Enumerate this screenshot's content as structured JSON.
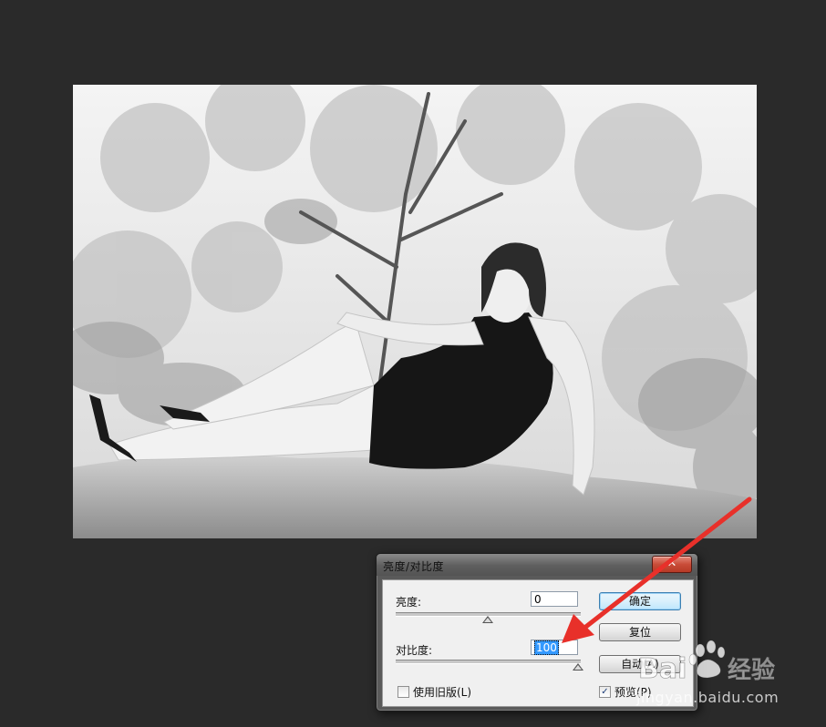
{
  "dialog": {
    "title": "亮度/对比度",
    "close_glyph": "✕",
    "brightness": {
      "label": "亮度:",
      "value": "0"
    },
    "contrast": {
      "label": "对比度:",
      "value": "100"
    },
    "buttons": {
      "ok": "确定",
      "reset": "复位",
      "auto": "自动(A)"
    },
    "legacy_checkbox": {
      "label": "使用旧版(L)",
      "checked": false
    },
    "preview_checkbox": {
      "label": "预览(P)",
      "checked": true,
      "check_glyph": "✓"
    }
  },
  "annotation": {
    "arrow_color": "#e8302a"
  },
  "watermark": {
    "logo_text": "Baidu经验",
    "url": "jingyan.baidu.com"
  },
  "colors": {
    "workspace_bg": "#2a2a2a",
    "dialog_frame": "#5a5a5a",
    "client_bg": "#f0f0f0",
    "selection": "#3399ff"
  }
}
